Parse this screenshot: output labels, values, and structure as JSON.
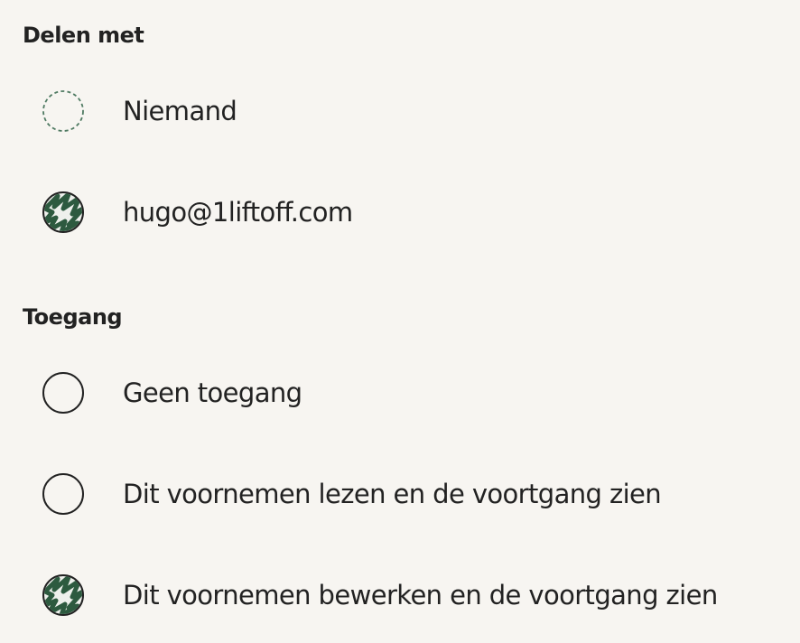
{
  "share_with": {
    "title": "Delen met",
    "options": [
      {
        "label": "Niemand",
        "selected": false,
        "style": "dashed"
      },
      {
        "label": "hugo@1liftoff.com",
        "selected": true,
        "style": "solid"
      }
    ]
  },
  "access": {
    "title": "Toegang",
    "options": [
      {
        "label": "Geen toegang",
        "selected": false
      },
      {
        "label": "Dit voornemen lezen en de voortgang zien",
        "selected": false
      },
      {
        "label": "Dit voornemen bewerken en de voortgang zien",
        "selected": true
      }
    ]
  },
  "colors": {
    "background": "#f7f5f1",
    "text": "#222222",
    "accent": "#2d5a3f",
    "dashed_ring": "#4f7a62"
  }
}
